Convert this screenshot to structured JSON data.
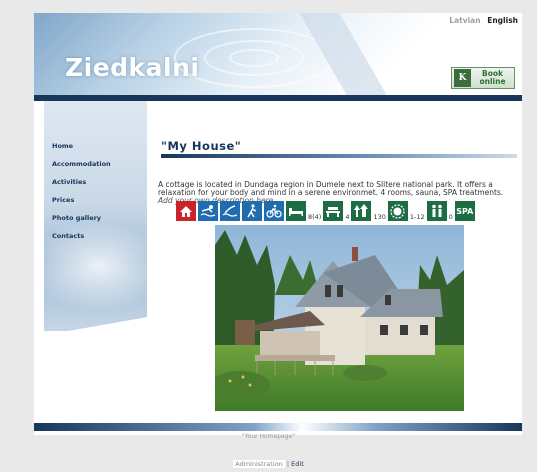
{
  "header": {
    "site_title": "Ziedkalni",
    "languages": [
      "Latvian",
      "English"
    ],
    "active_language": "English",
    "book_button": "Book online",
    "book_logo": "K"
  },
  "sidebar": {
    "items": [
      {
        "label": "Home"
      },
      {
        "label": "Accommodation"
      },
      {
        "label": "Activities"
      },
      {
        "label": "Prices"
      },
      {
        "label": "Photo gallery"
      },
      {
        "label": "Contacts"
      }
    ]
  },
  "main": {
    "heading": "\"My House\"",
    "description": "A cottage is located in Dundaga region in Dumele next to Slitere national park. It offers a relaxation for your body and mind in a serene environmet. 4 rooms, sauna, SPA treatments.",
    "add_own": "Add your own description here ...",
    "icon_numbers": [
      "8(4)",
      "4",
      "130",
      "1-12",
      "0"
    ],
    "spa_label": "SPA"
  },
  "footer": {
    "homepage": "\"Your Homepage\"",
    "admin": "Administration",
    "edit": "Edit"
  },
  "colors": {
    "navy": "#17365a",
    "red_icon": "#c8242b",
    "blue_icon": "#1f6db0",
    "green_icon": "#1d6d44"
  }
}
